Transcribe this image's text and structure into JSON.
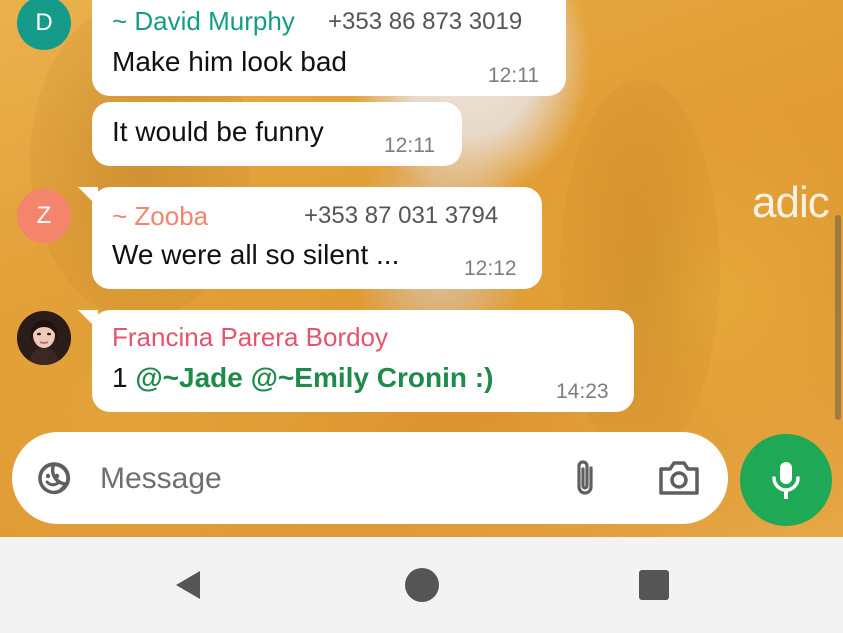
{
  "messages": [
    {
      "avatar_letter": "D",
      "avatar_color": "#159b8a",
      "sender": "~ David Murphy",
      "sender_color": "#159b8a",
      "phone": "+353 86 873 3019",
      "text": "Make him look bad",
      "time": "12:11"
    },
    {
      "text": "It would be funny",
      "time": "12:11"
    },
    {
      "avatar_letter": "Z",
      "avatar_color": "#f4846c",
      "sender": "~ Zooba",
      "sender_color": "#f4846c",
      "phone": "+353 87 031 3794",
      "text": "We were all so silent ...",
      "time": "12:12"
    },
    {
      "sender": "Francina Parera Bordoy",
      "sender_color": "#e5536c",
      "text_prefix": "1 ",
      "mention1": "@~Jade",
      "mention2": "@~Emily Cronin :)",
      "time": "14:23"
    }
  ],
  "wallpaper_text": "adic",
  "composer": {
    "placeholder": "Message"
  },
  "icons": {
    "emoji": "sticker-emoji-icon",
    "attach": "paperclip-icon",
    "camera": "camera-icon",
    "mic": "microphone-icon",
    "back": "nav-back-icon",
    "home": "nav-home-icon",
    "recents": "nav-recents-icon"
  },
  "colors": {
    "accent": "#1fa855",
    "mention": "#1f8a4c"
  }
}
